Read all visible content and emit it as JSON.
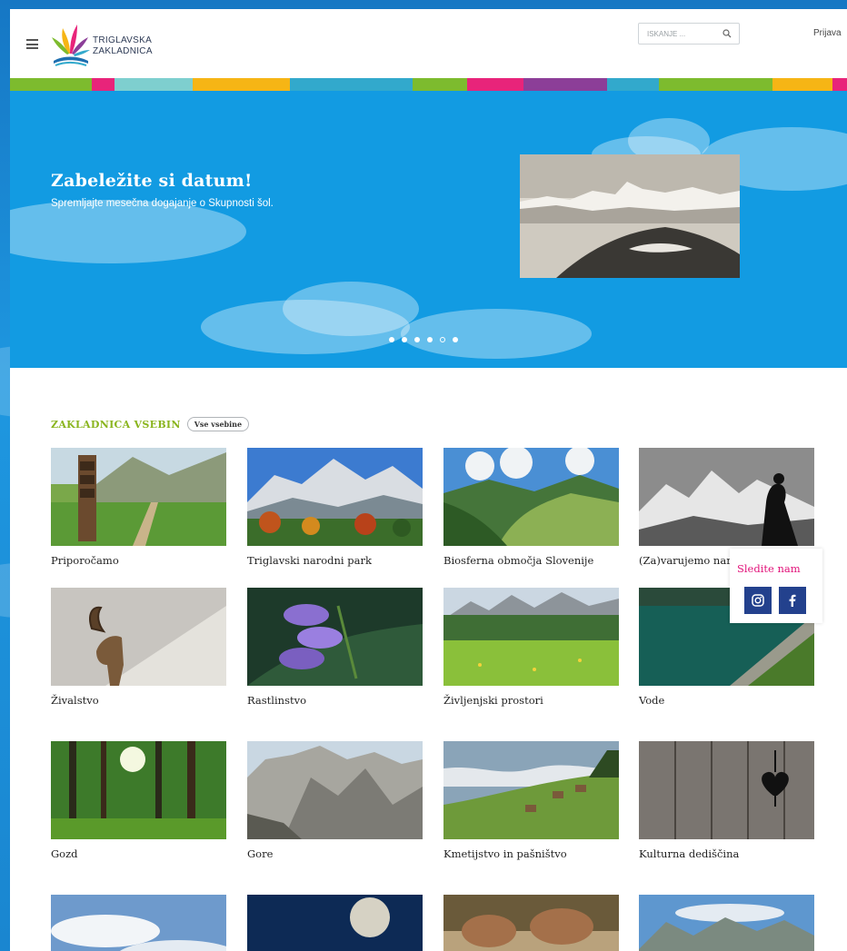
{
  "header": {
    "logo_line1": "TRIGLAVSKA",
    "logo_line2": "ZAKLADNICA",
    "search_placeholder": "ISKANJE ...",
    "login_label": "Prijava"
  },
  "strip_colors": [
    "#7dbb2e",
    "#e8247a",
    "#7ecfcf",
    "#f6b515",
    "#32a9cc",
    "#7dbb2e",
    "#e8247a",
    "#8c3e98",
    "#32a9cc",
    "#7dbb2e",
    "#f6b515",
    "#e8247a"
  ],
  "hero": {
    "title": "Zabeležite si datum!",
    "subtitle": "Spremljajte mesečna dogajanje o Skupnosti šol.",
    "slides": 6,
    "active_slide": 5
  },
  "section": {
    "title": "ZAKLADNICA VSEBIN",
    "all_label": "Vse vsebine"
  },
  "cards": [
    {
      "label": "Priporočamo",
      "icon": "trail-signpost"
    },
    {
      "label": "Triglavski narodni park",
      "icon": "mountain-autumn"
    },
    {
      "label": "Biosferna območja Slovenije",
      "icon": "green-valley"
    },
    {
      "label": "(Za)varujemo naravo",
      "icon": "bw-mountains-silhouette"
    },
    {
      "label": "Živalstvo",
      "icon": "ibex"
    },
    {
      "label": "Rastlinstvo",
      "icon": "bellflower"
    },
    {
      "label": "Življenjski prostori",
      "icon": "alpine-meadow"
    },
    {
      "label": "Vode",
      "icon": "lake"
    },
    {
      "label": "Gozd",
      "icon": "forest"
    },
    {
      "label": "Gore",
      "icon": "rock-face"
    },
    {
      "label": "Kmetijstvo in pašništvo",
      "icon": "pasture-huts"
    },
    {
      "label": "Kulturna dediščina",
      "icon": "wooden-door-heart"
    },
    {
      "label": "",
      "icon": "sky-clouds"
    },
    {
      "label": "",
      "icon": "moon"
    },
    {
      "label": "",
      "icon": "hands-craft"
    },
    {
      "label": "",
      "icon": "mountain-valley"
    }
  ],
  "follow": {
    "title": "Sledite nam",
    "networks": [
      "instagram-icon",
      "facebook-icon"
    ]
  }
}
